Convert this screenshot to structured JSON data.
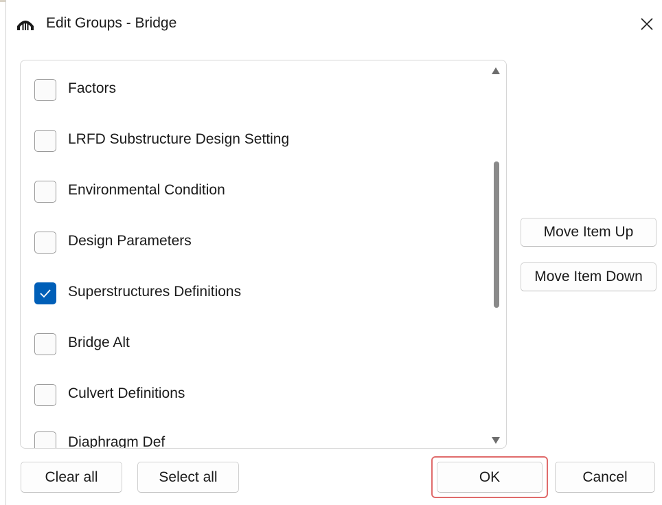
{
  "window": {
    "title": "Edit Groups - Bridge",
    "app_icon": "bridge-arch-icon",
    "close_icon": "close-icon"
  },
  "groups": {
    "items": [
      {
        "label": "Factors",
        "checked": false
      },
      {
        "label": "LRFD Substructure Design Setting",
        "checked": false
      },
      {
        "label": "Environmental Condition",
        "checked": false
      },
      {
        "label": "Design Parameters",
        "checked": false
      },
      {
        "label": "Superstructures Definitions",
        "checked": true
      },
      {
        "label": "Bridge Alt",
        "checked": false
      },
      {
        "label": "Culvert Definitions",
        "checked": false
      },
      {
        "label": "Diaphragm Def",
        "checked": false
      }
    ]
  },
  "side_buttons": {
    "move_up": "Move Item Up",
    "move_down": "Move Item Down"
  },
  "footer": {
    "clear_all": "Clear all",
    "select_all": "Select all",
    "ok": "OK",
    "cancel": "Cancel"
  },
  "colors": {
    "accent": "#005fb8",
    "highlight": "#e06b6b"
  }
}
